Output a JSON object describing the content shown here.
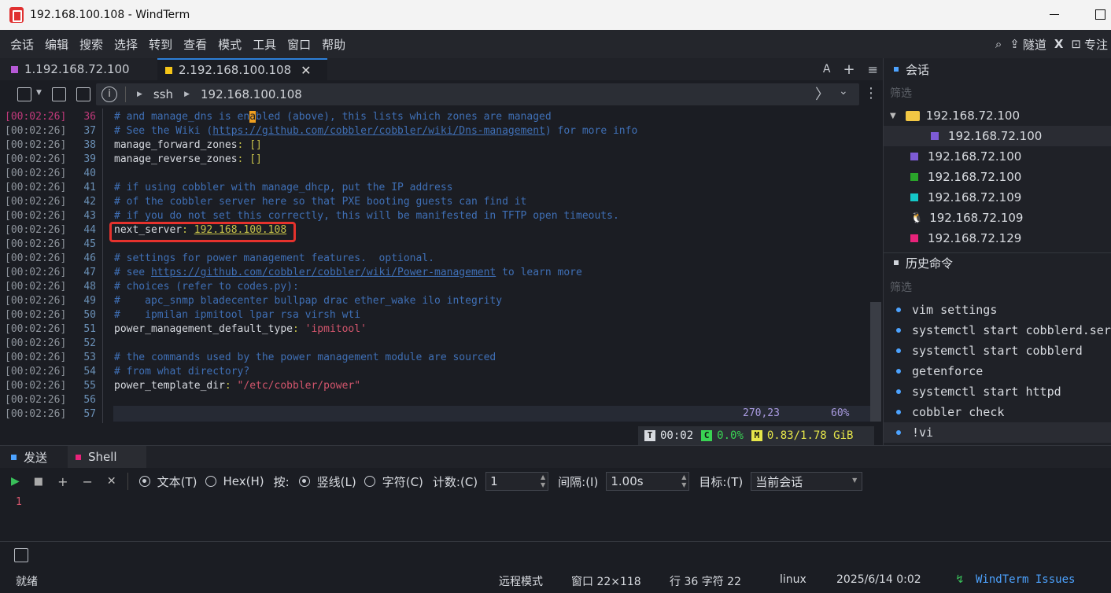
{
  "window": {
    "title": "192.168.100.108 - WindTerm"
  },
  "menu": {
    "items": [
      "会话",
      "编辑",
      "搜索",
      "选择",
      "转到",
      "查看",
      "模式",
      "工具",
      "窗口",
      "帮助"
    ],
    "tunnel": "隧道",
    "focus": "专注"
  },
  "tabs": [
    {
      "label": "1.192.168.72.100",
      "color": "#b659d6"
    },
    {
      "label": "2.192.168.100.108",
      "color": "#f5c518"
    }
  ],
  "tab_actions": {
    "font": "A",
    "add": "+",
    "list": "≡"
  },
  "address": {
    "protocol": "ssh",
    "host": "192.168.100.108"
  },
  "terminal": {
    "timestamp": "[00:02:26]",
    "lines": [
      {
        "n": "36",
        "parts": [
          [
            "cm",
            "# and manage_dns is en"
          ],
          [
            "cursor",
            "a"
          ],
          [
            "cm",
            "bled (above), this lists which zones are managed"
          ]
        ]
      },
      {
        "n": "37",
        "parts": [
          [
            "cm",
            "# See the Wiki ("
          ],
          [
            "cmu",
            "https://github.com/cobbler/cobbler/wiki/Dns-management"
          ],
          [
            "cm",
            ") for more info"
          ]
        ]
      },
      {
        "n": "38",
        "parts": [
          [
            "key",
            "manage_forward_zones"
          ],
          [
            "val",
            ": []"
          ]
        ]
      },
      {
        "n": "39",
        "parts": [
          [
            "key",
            "manage_reverse_zones"
          ],
          [
            "val",
            ": []"
          ]
        ]
      },
      {
        "n": "40",
        "parts": []
      },
      {
        "n": "41",
        "parts": [
          [
            "cm",
            "# if using cobbler with manage_dhcp, put the IP address"
          ]
        ]
      },
      {
        "n": "42",
        "parts": [
          [
            "cm",
            "# of the cobbler server here so that PXE booting guests can find it"
          ]
        ]
      },
      {
        "n": "43",
        "parts": [
          [
            "cm",
            "# if you do not set this correctly, this will be manifested in TFTP open timeouts."
          ]
        ]
      },
      {
        "n": "44",
        "parts": [
          [
            "key",
            "next_server"
          ],
          [
            "val",
            ": "
          ],
          [
            "valu",
            "192.168.100.108"
          ]
        ]
      },
      {
        "n": "45",
        "parts": []
      },
      {
        "n": "46",
        "parts": [
          [
            "cm",
            "# settings for power management features.  optional."
          ]
        ]
      },
      {
        "n": "47",
        "parts": [
          [
            "cm",
            "# see "
          ],
          [
            "cmu",
            "https://github.com/cobbler/cobbler/wiki/Power-management"
          ],
          [
            "cm",
            " to learn more"
          ]
        ]
      },
      {
        "n": "48",
        "parts": [
          [
            "cm",
            "# choices (refer to codes.py):"
          ]
        ]
      },
      {
        "n": "49",
        "parts": [
          [
            "cm",
            "#    apc_snmp bladecenter bullpap drac ether_wake ilo integrity"
          ]
        ]
      },
      {
        "n": "50",
        "parts": [
          [
            "cm",
            "#    ipmilan ipmitool lpar rsa virsh wti"
          ]
        ]
      },
      {
        "n": "51",
        "parts": [
          [
            "key",
            "power_management_default_type"
          ],
          [
            "val",
            ": "
          ],
          [
            "str",
            "'ipmitool'"
          ]
        ]
      },
      {
        "n": "52",
        "parts": []
      },
      {
        "n": "53",
        "parts": [
          [
            "cm",
            "# the commands used by the power management module are sourced"
          ]
        ]
      },
      {
        "n": "54",
        "parts": [
          [
            "cm",
            "# from what directory?"
          ]
        ]
      },
      {
        "n": "55",
        "parts": [
          [
            "key",
            "power_template_dir"
          ],
          [
            "val",
            ": "
          ],
          [
            "str",
            "\"/etc/cobbler/power\""
          ]
        ]
      },
      {
        "n": "56",
        "parts": []
      },
      {
        "n": "57",
        "parts": []
      }
    ],
    "status_pos": "270,23",
    "status_pct": "60%"
  },
  "sysmon": {
    "time_badge": "T",
    "time": "00:02",
    "cpu_badge": "C",
    "cpu": "0.0%",
    "mem_badge": "M",
    "mem": "0.83/1.78 GiB"
  },
  "sessions_panel": {
    "header": "会话",
    "filter": "筛选",
    "folder": "192.168.72.100",
    "items": [
      {
        "label": "192.168.72.100",
        "color": "#7d5bd6",
        "indent": 2
      },
      {
        "label": "192.168.72.100",
        "color": "#7d5bd6",
        "indent": 1
      },
      {
        "label": "192.168.72.100",
        "color": "#2aa52a",
        "indent": 1
      },
      {
        "label": "192.168.72.109",
        "color": "#14c8c8",
        "indent": 1
      },
      {
        "label": "192.168.72.109",
        "color": "penguin",
        "indent": 1
      },
      {
        "label": "192.168.72.129",
        "color": "#e8237a",
        "indent": 1
      }
    ]
  },
  "history_panel": {
    "header": "历史命令",
    "filter": "筛选",
    "items": [
      "vim settings",
      "systemctl start cobblerd.service",
      "systemctl start cobblerd",
      "getenforce",
      "systemctl start httpd",
      "cobbler check",
      "!vi"
    ]
  },
  "send_panel": {
    "tabs": [
      {
        "label": "发送",
        "color": "#4da3ff"
      },
      {
        "label": "Shell",
        "color": "#e8237a"
      }
    ],
    "text_mode": "文本(T)",
    "hex_mode": "Hex(H)",
    "by_label": "按:",
    "by_line": "竖线(L)",
    "by_char": "字符(C)",
    "count_label": "计数:(C)",
    "count_value": "1",
    "interval_label": "间隔:(I)",
    "interval_value": "1.00s",
    "target_label": "目标:(T)",
    "target_value": "当前会话",
    "editor_line": "1"
  },
  "statusbar": {
    "ready": "就绪",
    "mode": "远程模式",
    "window": "窗口 22×118",
    "cursor": "行 36 字符 22",
    "os": "linux",
    "datetime": "2025/6/14 0:02",
    "issues": "WindTerm Issues"
  }
}
